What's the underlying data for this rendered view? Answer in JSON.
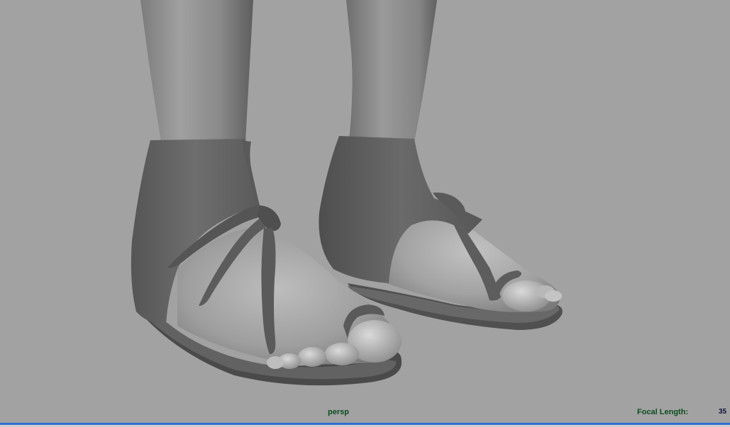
{
  "viewport": {
    "camera_name": "persp",
    "focal_length_label": "Focal Length:",
    "focal_length_value": "35",
    "active": true
  },
  "scene": {
    "subject": "sandals-on-feet-model",
    "shading": "gray-smooth-shaded"
  },
  "colors": {
    "background": "#a2a2a2",
    "hud_text": "#0d4d1f",
    "active_border": "#2f6fd0"
  }
}
